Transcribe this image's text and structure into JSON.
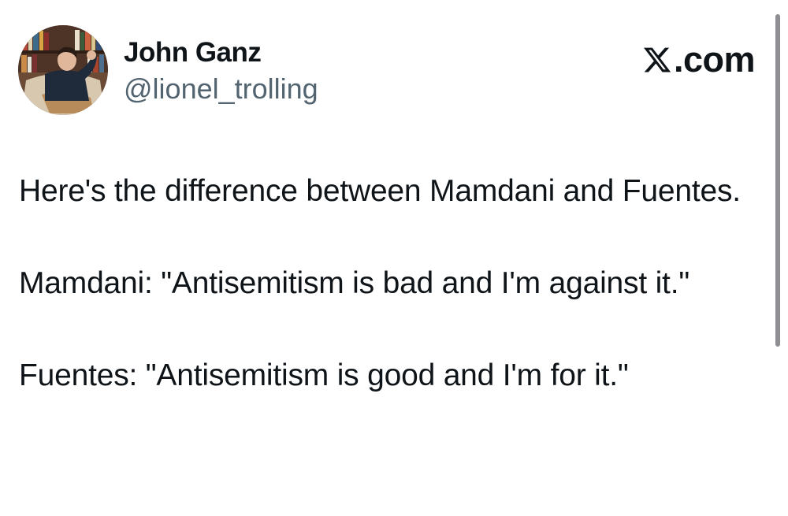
{
  "author": {
    "display_name": "John Ganz",
    "handle": "@lionel_trolling",
    "avatar_icon": "profile-photo"
  },
  "brand": {
    "label": ".com",
    "icon": "x-logo-icon"
  },
  "tweet": {
    "paragraphs": [
      "Here's the difference between Mamdani and Fuentes.",
      "Mamdani: \"Antisemitism is bad and I'm against it.\"",
      "Fuentes: \"Antisemitism is good and I'm for it.\""
    ]
  },
  "colors": {
    "text": "#0f1419",
    "secondary_text": "#536471",
    "background": "#ffffff",
    "scrollbar": "#8e8e93"
  }
}
